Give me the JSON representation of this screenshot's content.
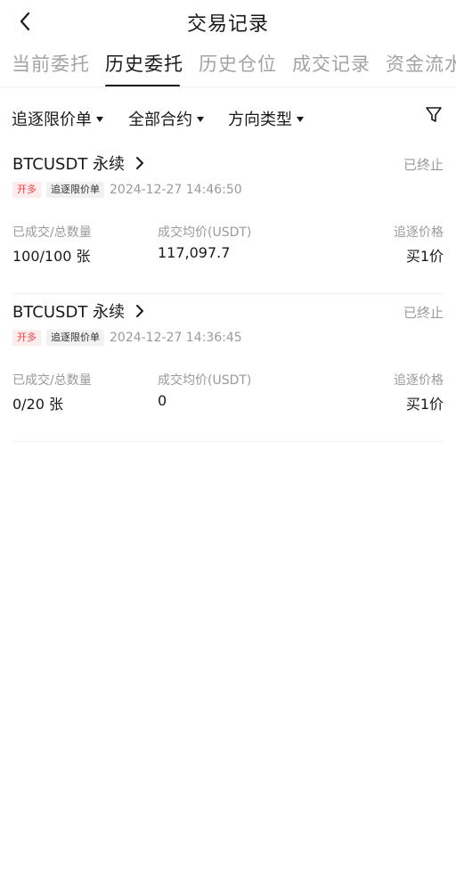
{
  "header": {
    "title": "交易记录"
  },
  "tabs": [
    {
      "label": "当前委托"
    },
    {
      "label": "历史委托"
    },
    {
      "label": "历史仓位"
    },
    {
      "label": "成交记录"
    },
    {
      "label": "资金流水"
    }
  ],
  "active_tab": "历史委托",
  "filters": {
    "order_type": "追逐限价单",
    "contracts": "全部合约",
    "direction": "方向类型"
  },
  "labels": {
    "filled_total": "已成交/总数量",
    "avg_price": "成交均价(USDT)",
    "chase_price": "追逐价格"
  },
  "orders": [
    {
      "symbol": "BTCUSDT 永续",
      "status": "已终止",
      "side_tag": "开多",
      "type_tag": "追逐限价单",
      "time": "2024-12-27 14:46:50",
      "filled_total": "100/100 张",
      "avg_price": "117,097.7",
      "chase_price": "买1价"
    },
    {
      "symbol": "BTCUSDT 永续",
      "status": "已终止",
      "side_tag": "开多",
      "type_tag": "追逐限价单",
      "time": "2024-12-27 14:36:45",
      "filled_total": "0/20 张",
      "avg_price": "0",
      "chase_price": "买1价"
    }
  ],
  "icons": {
    "back": "chevron-left-icon",
    "filter": "funnel-icon",
    "detail": "chevron-right-icon",
    "dropdown": "caret-down-icon"
  },
  "colors": {
    "side_tag_text": "#e5484d",
    "side_tag_bg": "#fdecec",
    "muted_text": "#9a9a9a",
    "primary_text": "#1a1a1a"
  }
}
